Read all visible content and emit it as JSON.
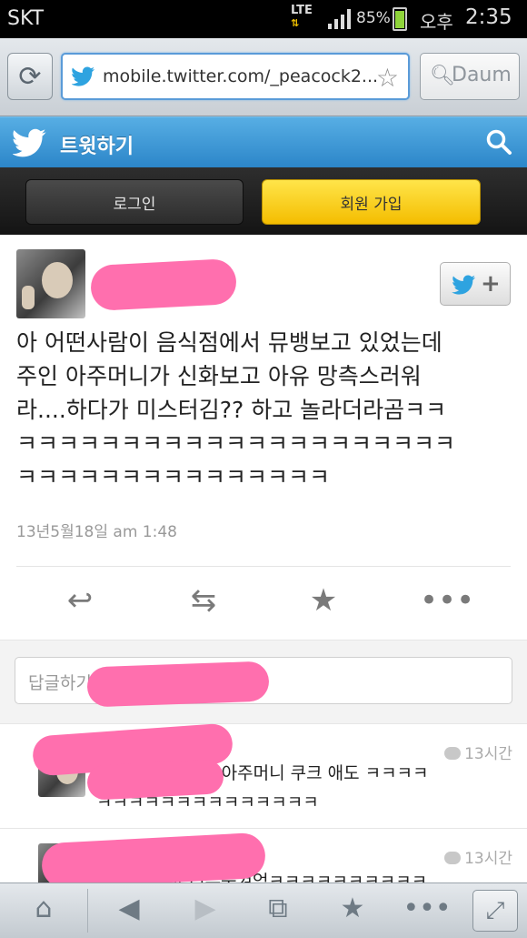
{
  "status_bar": {
    "carrier": "SKT",
    "network": "LTE",
    "battery": "85%",
    "ampm": "오후",
    "time": "2:35"
  },
  "browser": {
    "url": "mobile.twitter.com/_peacock2...",
    "search_engine": "Daum",
    "refresh_icon": "refresh-icon",
    "bookmark_icon": "star-outline-icon",
    "search_icon": "magnifier-icon"
  },
  "twitter_header": {
    "title": "트윗하기",
    "brand_color": "#2c86c9",
    "logo_icon": "twitter-bird-icon",
    "search_icon": "magnifier-icon"
  },
  "auth": {
    "login_label": "로그인",
    "signup_label": "회원 가입",
    "signup_color": "#f4bd00"
  },
  "tweet": {
    "text": "아 어떤사람이 음식점에서 뮤뱅보고 있었는데\n주인 아주머니가 신화보고 아유 망측스러워\n라....하다가 미스터김?? 하고 놀라더라곰ㅋㅋ\nㅋㅋㅋㅋㅋㅋㅋㅋㅋㅋㅋㅋㅋㅋㅋㅋㅋㅋㅋㅋㅋ\nㅋㅋㅋㅋㅋㅋㅋㅋㅋㅋㅋㅋㅋㅋㅋ",
    "timestamp": "13년5월18일 am 1:48",
    "follow_icon": "twitter-bird-icon",
    "follow_plus": "+",
    "actions": {
      "reply": "↩",
      "retweet": "⇆",
      "favorite": "★",
      "more": "•••"
    }
  },
  "reply_box": {
    "placeholder": "답글하기"
  },
  "replies": [
    {
      "time": "13시간",
      "text": "                어휴 아주머니 쿠크 애도 ㅋㅋㅋㅋ\nㅋㅋㅋㅋㅋㅋㅋㅋㅋㅋㅋㅋㅋㅋ"
    },
    {
      "time": "13시간",
      "text": "             아 너무웃겨엌ㅋㅋㅋㅋㅋㅋㅋㅋㅋㅋ"
    }
  ],
  "bottom_bar": {
    "home": "⌂",
    "back": "◀",
    "forward": "▶",
    "tabs": "⧉",
    "bookmarks": "★",
    "menu": "•••",
    "fullscreen": "⤢"
  }
}
